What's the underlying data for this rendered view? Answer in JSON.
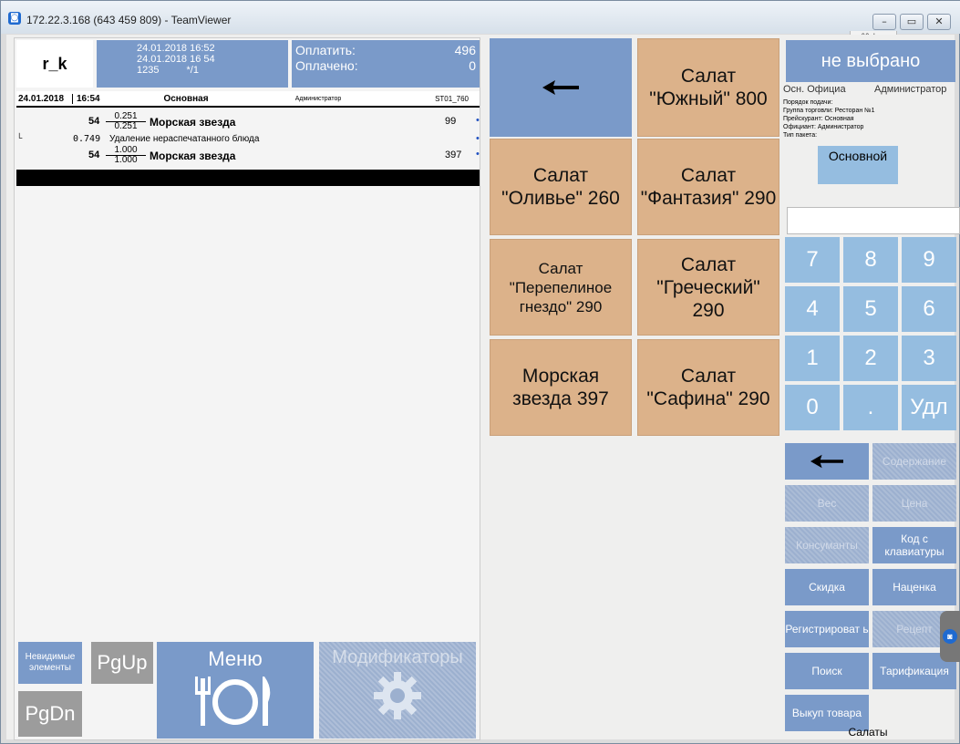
{
  "window": {
    "title": "172.22.3.168 (643 459 809) - TeamViewer"
  },
  "header": {
    "user_code": "r_k",
    "date1": "24.01.2018 16:52",
    "date2": "24.01.2018 16 54",
    "code": "1235",
    "guests": "*/1",
    "to_pay_label": "Оплатить:",
    "to_pay_value": "496",
    "paid_label": "Оплачено:",
    "paid_value": "0"
  },
  "order": {
    "date": "24.01.2018",
    "time": "16:54",
    "section": "Основная",
    "waiter": "Администратор",
    "station": "ST01_760",
    "lines": [
      {
        "code": "54",
        "qty_top": "0.251",
        "qty_bottom": "0.251",
        "name": "Морская звезда",
        "price": "99"
      },
      {
        "prefix": "0.749",
        "name": "Удаление нераспечатанного блюда"
      },
      {
        "code": "54",
        "qty_top": "1.000",
        "qty_bottom": "1.000",
        "name": "Морская звезда",
        "price": "397"
      }
    ]
  },
  "left_buttons": {
    "invisible": "Невидимые элементы",
    "pgup": "PgUp",
    "pgdn": "PgDn",
    "menu": "Меню",
    "modifiers": "Модификаторы"
  },
  "menu_items": [
    {
      "label": "Салат \"Южный\" 800"
    },
    {
      "label": "Салат \"Оливье\" 260"
    },
    {
      "label": "Салат \"Фантазия\" 290"
    },
    {
      "label": "Салат \"Перепелиное гнездо\" 290"
    },
    {
      "label": "Салат \"Греческий\" 290"
    },
    {
      "label": "Морская звезда 397"
    },
    {
      "label": "Салат \"Сафина\" 290"
    }
  ],
  "right": {
    "not_selected": "не выбрано",
    "info_office": "Осн. Официа",
    "info_admin": "Администратор",
    "info_lines": [
      "Порядок подачи:",
      "Группа торговли: Ресторан №1",
      "Прейскурант: Основная",
      "Официант: Администратор",
      "Тип пакета:"
    ],
    "basic_button": "Основной",
    "keys": [
      "7",
      "8",
      "9",
      "4",
      "5",
      "6",
      "1",
      "2",
      "3",
      "0",
      ".",
      "Удл"
    ],
    "func": {
      "content": "Содержание",
      "weight": "Вес",
      "price": "Цена",
      "consumables": "Консуманты",
      "keyboard_code": "Код с клавиатуры",
      "discount": "Скидка",
      "markup": "Наценка",
      "register": "Регистрироват ь",
      "recipe": "Рецепт",
      "search": "Поиск",
      "tariff": "Тарификация",
      "buyback": "Выкуп товара"
    },
    "category": "Салаты"
  },
  "colors": {
    "blue": "#7a9ac9",
    "light_blue": "#95bde0",
    "menu_item": "#dcb28a",
    "disabled": "#9cb0cf"
  }
}
